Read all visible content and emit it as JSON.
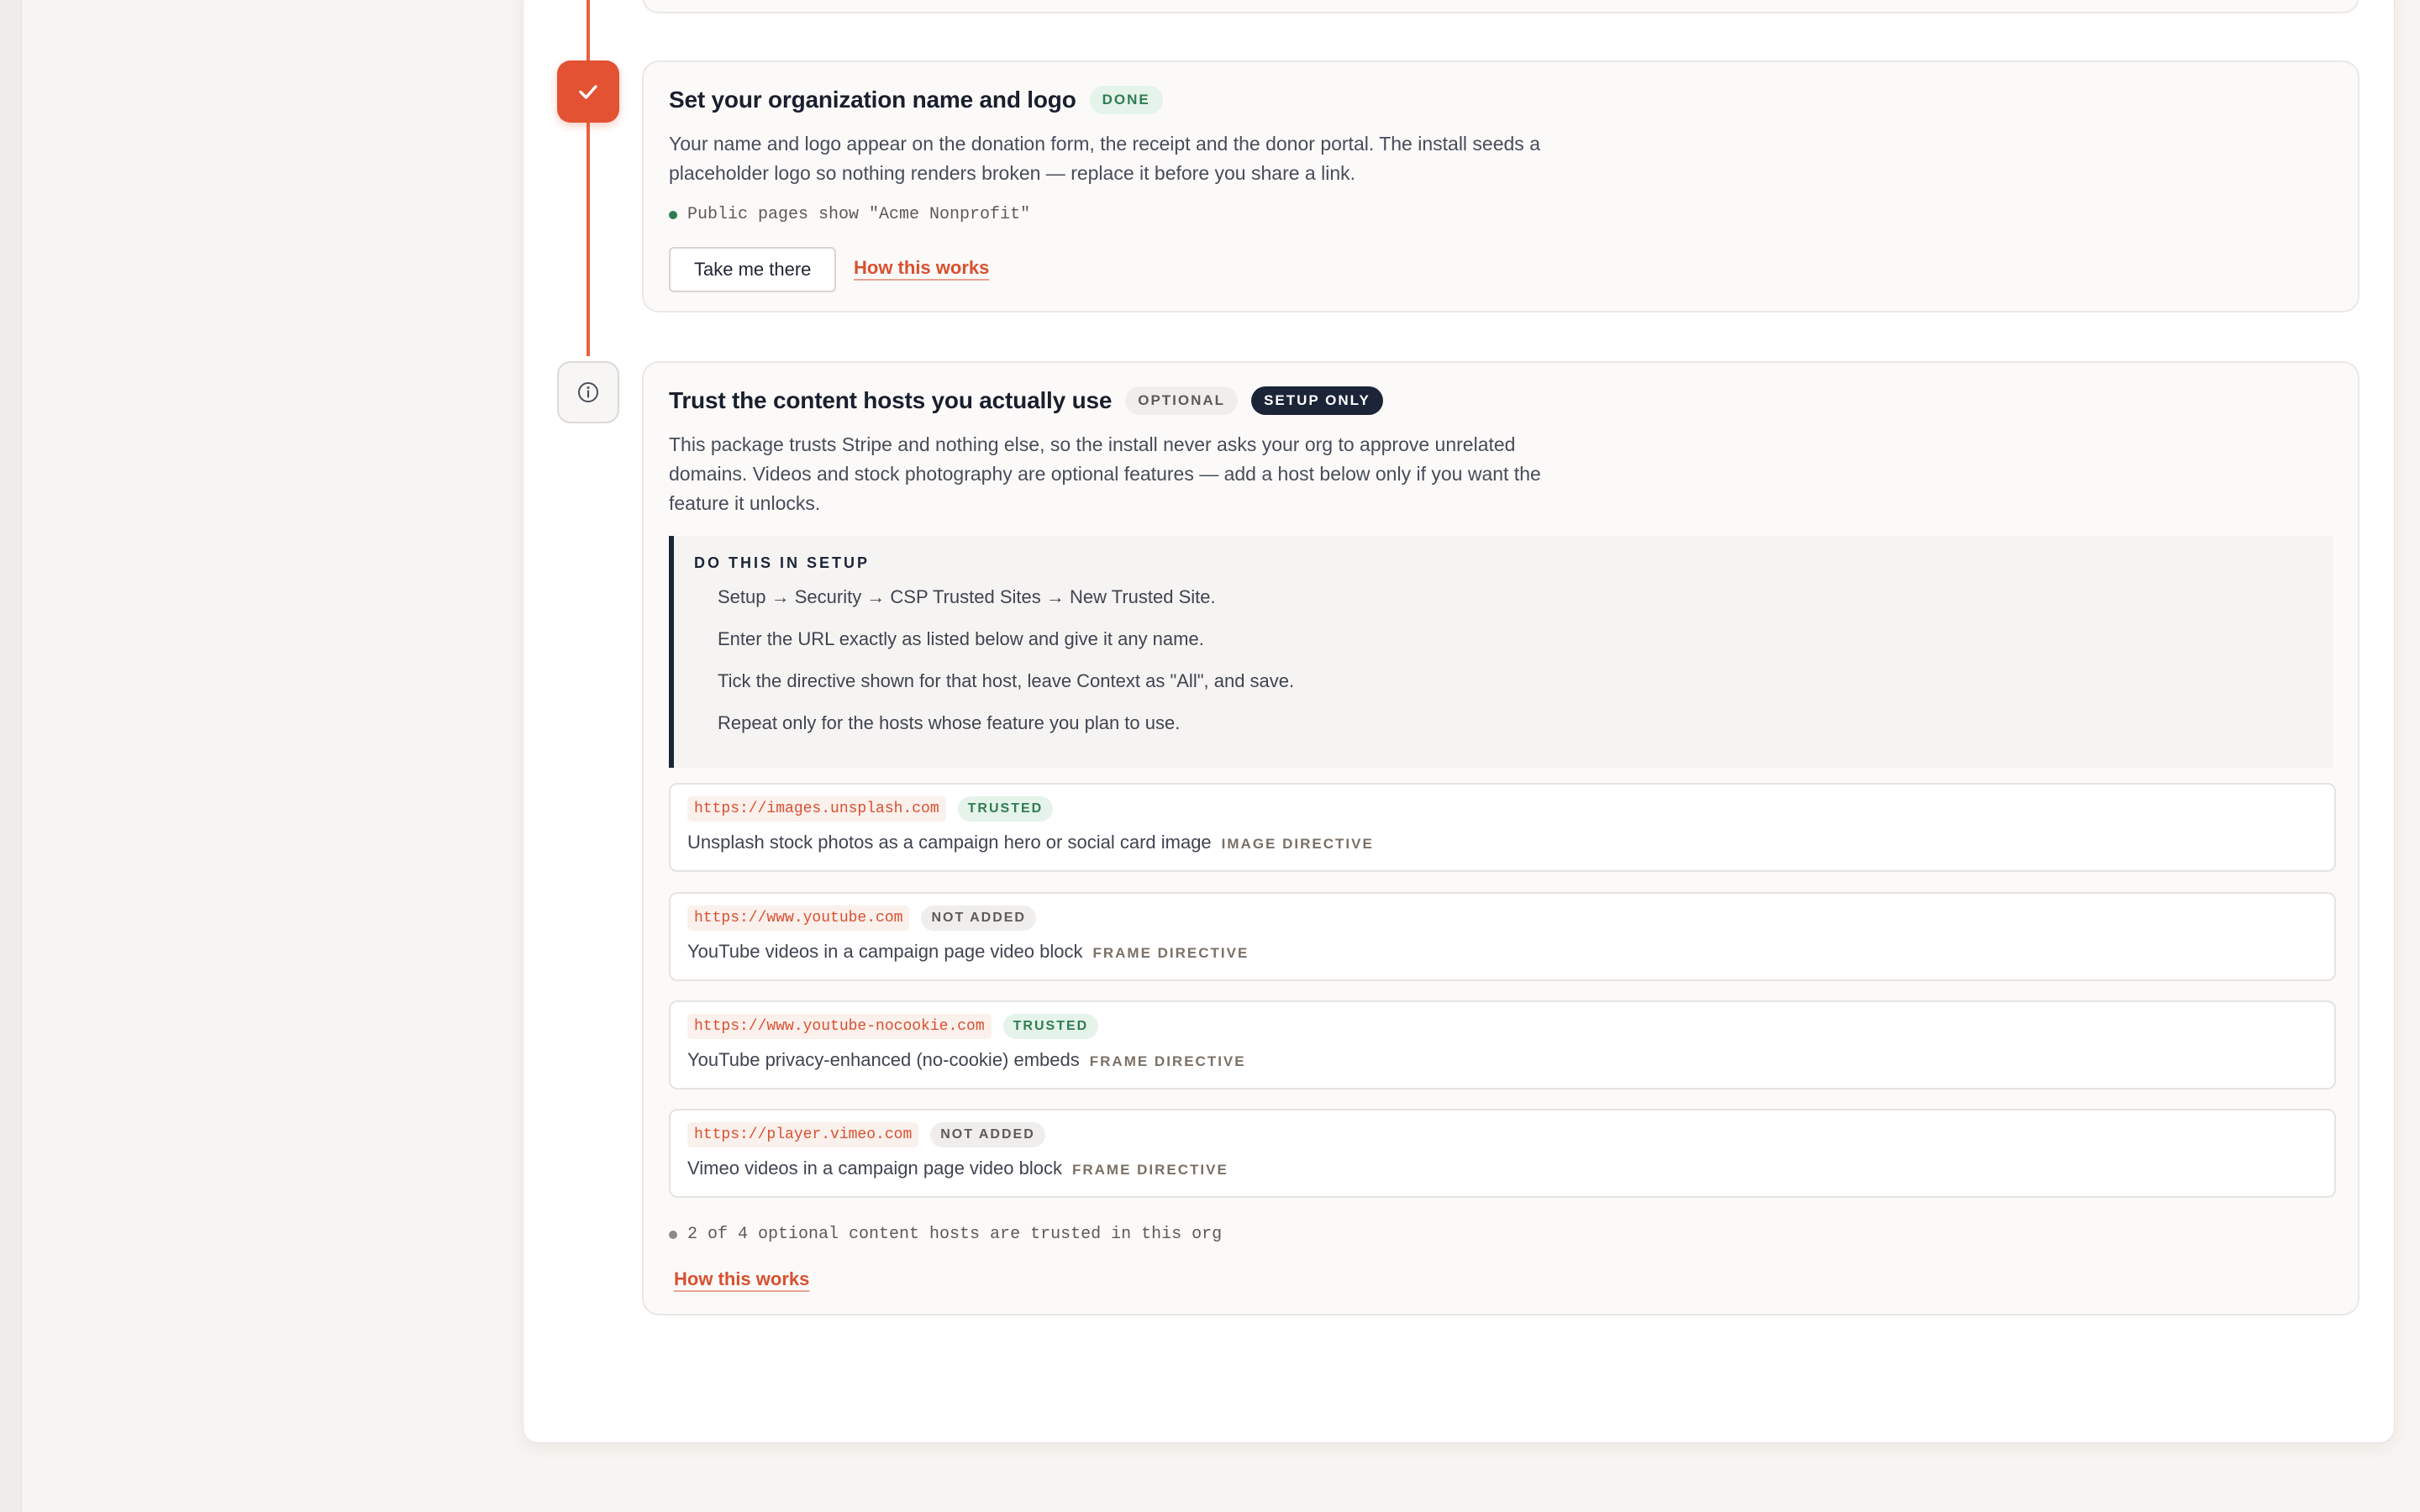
{
  "steps": [
    {
      "title": "Set your organization name and logo",
      "badges": [
        "DONE"
      ],
      "description": "Your name and logo appear on the donation form, the receipt and the donor portal. The install seeds a placeholder logo so nothing renders broken — replace it before you share a link.",
      "status": "Public pages show \"Acme Nonprofit\"",
      "primary_button": "Take me there",
      "link": "How this works"
    },
    {
      "title": "Trust the content hosts you actually use",
      "badges": [
        "OPTIONAL",
        "SETUP ONLY"
      ],
      "description": "This package trusts Stripe and nothing else, so the install never asks your org to approve unrelated domains. Videos and stock photography are optional features — add a host below only if you want the feature it unlocks.",
      "callout": {
        "heading": "DO THIS IN SETUP",
        "steps": [
          "Setup → Security → CSP Trusted Sites → New Trusted Site.",
          "Enter the URL exactly as listed below and give it any name.",
          "Tick the directive shown for that host, leave Context as \"All\", and save.",
          "Repeat only for the hosts whose feature you plan to use."
        ]
      },
      "hosts": [
        {
          "url": "https://images.unsplash.com",
          "status": "TRUSTED",
          "description": "Unsplash stock photos as a campaign hero or social card image",
          "directive": "IMAGE DIRECTIVE"
        },
        {
          "url": "https://www.youtube.com",
          "status": "NOT ADDED",
          "description": "YouTube videos in a campaign page video block",
          "directive": "FRAME DIRECTIVE"
        },
        {
          "url": "https://www.youtube-nocookie.com",
          "status": "TRUSTED",
          "description": "YouTube privacy-enhanced (no-cookie) embeds",
          "directive": "FRAME DIRECTIVE"
        },
        {
          "url": "https://player.vimeo.com",
          "status": "NOT ADDED",
          "description": "Vimeo videos in a campaign page video block",
          "directive": "FRAME DIRECTIVE"
        }
      ],
      "status": "2 of 4 optional content hosts are trusted in this org",
      "link": "How this works"
    }
  ],
  "colors": {
    "accent": "#e35232",
    "success": "#2f7d52",
    "navy": "#1c2438"
  },
  "icons": {
    "step1": "check-icon",
    "step2": "info-icon"
  }
}
